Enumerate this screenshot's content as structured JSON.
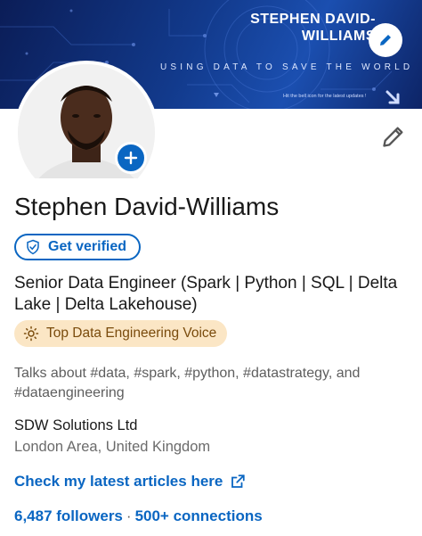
{
  "banner": {
    "title_line1": "STEPHEN DAVID-",
    "title_line2": "WILLIAMS",
    "subtitle": "USING DATA TO SAVE THE WORLD",
    "note": "Hit the bell icon for the latest updates !"
  },
  "profile": {
    "name": "Stephen David-Williams",
    "verify_label": "Get verified",
    "headline": "Senior Data Engineer (Spark | Python | SQL | Delta Lake | Delta Lakehouse)",
    "badge_label": "Top Data Engineering Voice",
    "talks_about": "Talks about #data, #spark, #python, #datastrategy, and #dataengineering",
    "company": "SDW Solutions Ltd",
    "location": "London Area, United Kingdom",
    "link_label": "Check my latest articles here",
    "followers": "6,487 followers",
    "separator": "·",
    "connections": "500+ connections"
  },
  "icons": {
    "banner_edit": "pencil-icon",
    "profile_edit": "pencil-icon",
    "add_photo": "plus-icon",
    "verified": "shield-check-icon",
    "voice": "sun-icon",
    "external_link": "external-link-icon"
  },
  "colors": {
    "brand_blue": "#0a66c2",
    "banner_dark": "#0b1d57",
    "badge_bg": "#fbe6c5",
    "badge_text": "#7a4b0c"
  }
}
